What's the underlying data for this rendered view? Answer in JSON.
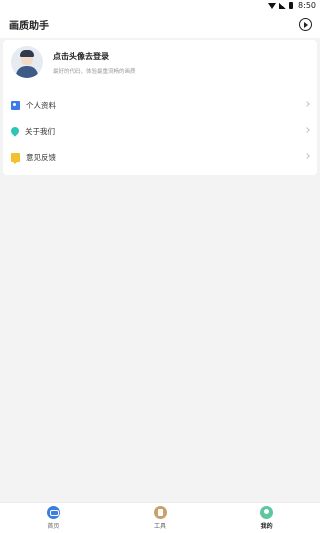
{
  "status_bar": {
    "time": "8:50"
  },
  "app_bar": {
    "title": "画质助手"
  },
  "profile": {
    "title": "点击头像去登录",
    "subtitle": "最好的代码，体验最重流畅的画质"
  },
  "menu": {
    "items": [
      {
        "label": "个人资料",
        "icon": "id-card-icon"
      },
      {
        "label": "关于我们",
        "icon": "lightbulb-icon"
      },
      {
        "label": "意见反馈",
        "icon": "feedback-icon"
      }
    ]
  },
  "tabs": [
    {
      "label": "首页",
      "icon": "gamepad-icon",
      "active": false
    },
    {
      "label": "工具",
      "icon": "tools-icon",
      "active": false
    },
    {
      "label": "我的",
      "icon": "user-icon",
      "active": true
    }
  ],
  "colors": {
    "home_icon": "#3a7ee0",
    "tools_icon": "#c9a06a",
    "mine_icon": "#5fc7a0",
    "background": "#f3f3f3"
  }
}
